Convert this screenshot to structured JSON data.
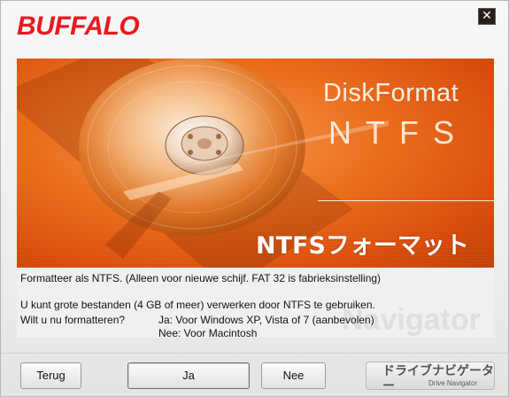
{
  "brand": {
    "logo_text": "BUFFALO"
  },
  "window": {
    "close_label": "✕"
  },
  "banner": {
    "title": "DiskFormat",
    "subtitle": "NTFS",
    "jp_title": "NTFSフォーマット"
  },
  "info": {
    "line1": "Formatteer als NTFS. (Alleen voor nieuwe schijf. FAT 32 is fabrieksinstelling)",
    "line2": "U kunt grote bestanden (4 GB of meer) verwerken door NTFS te gebruiken.",
    "question": "Wilt u nu formatteren?",
    "option_yes": "Ja:  Voor Windows XP, Vista of 7 (aanbevolen)",
    "option_no": "Nee: Voor Macintosh"
  },
  "watermark": "Navigator",
  "buttons": {
    "back": "Terug",
    "yes": "Ja",
    "no": "Nee"
  },
  "drive_navigator": {
    "jp": "ドライブナビゲーター",
    "en": "Drive Navigator"
  },
  "colors": {
    "brand_red": "#e8191f",
    "banner_orange": "#e35f12",
    "close_bg": "#2b1e1a"
  }
}
